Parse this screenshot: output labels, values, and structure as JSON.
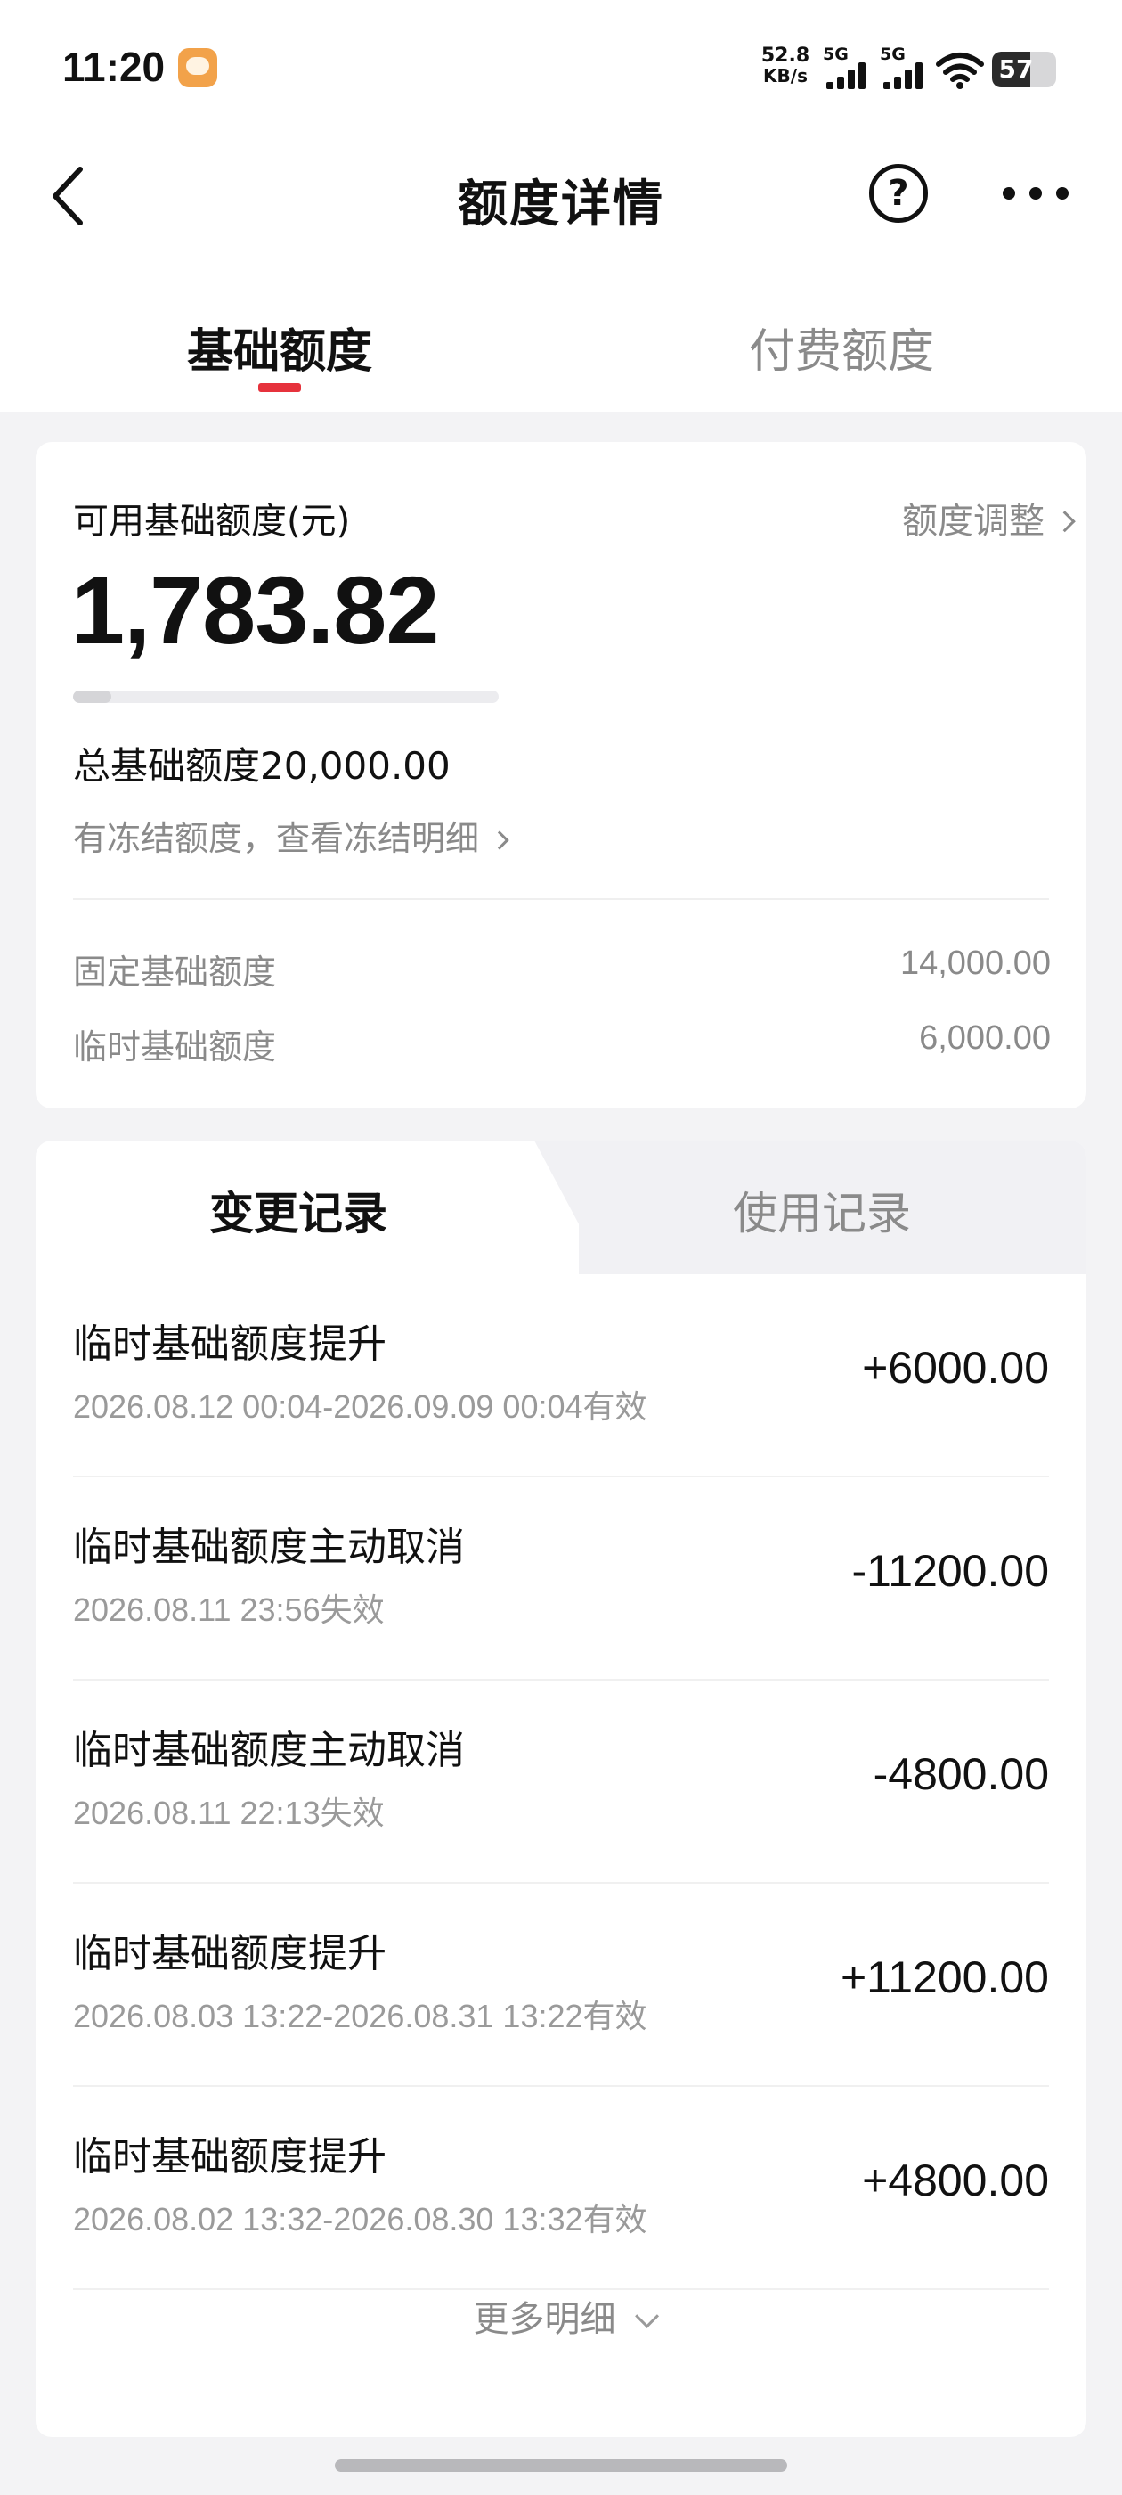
{
  "status_bar": {
    "time": "11:20",
    "net_speed_value": "52.8",
    "net_speed_unit": "KB/s",
    "signal_1": "5G",
    "signal_2": "5G",
    "battery": "57",
    "battery_level_percent": 57,
    "app_icon": "app-notification-icon"
  },
  "nav": {
    "back_icon": "chevron-left-icon",
    "title": "额度详情",
    "help_icon": "help-icon",
    "help_symbol": "?",
    "more_icon": "more-icon"
  },
  "tabs": [
    {
      "label": "基础额度",
      "active": true
    },
    {
      "label": "付费额度",
      "active": false
    }
  ],
  "quota": {
    "available_label": "可用基础额度(元)",
    "adjust_link": "额度调整",
    "available_amount": "1,783.82",
    "usage_fraction": 0.089,
    "total_label": "总基础额度20,000.00",
    "frozen_link": "有冻结额度，查看冻结明细",
    "rows": [
      {
        "label": "固定基础额度",
        "value": "14,000.00"
      },
      {
        "label": "临时基础额度",
        "value": "6,000.00"
      }
    ]
  },
  "records": {
    "tabs": [
      {
        "label": "变更记录",
        "active": true
      },
      {
        "label": "使用记录",
        "active": false
      }
    ],
    "items": [
      {
        "title": "临时基础额度提升",
        "time": "2026.08.12 00:04-2026.09.09 00:04有效",
        "amount": "+6000.00"
      },
      {
        "title": "临时基础额度主动取消",
        "time": "2026.08.11 23:56失效",
        "amount": "-11200.00"
      },
      {
        "title": "临时基础额度主动取消",
        "time": "2026.08.11 22:13失效",
        "amount": "-4800.00"
      },
      {
        "title": "临时基础额度提升",
        "time": "2026.08.03 13:22-2026.08.31 13:22有效",
        "amount": "+11200.00"
      },
      {
        "title": "临时基础额度提升",
        "time": "2026.08.02 13:32-2026.08.30 13:32有效",
        "amount": "+4800.00"
      }
    ],
    "more_label": "更多明细"
  },
  "colors": {
    "accent": "#e6323c",
    "background": "#f3f3f5",
    "muted_text": "#8a8a8a"
  }
}
